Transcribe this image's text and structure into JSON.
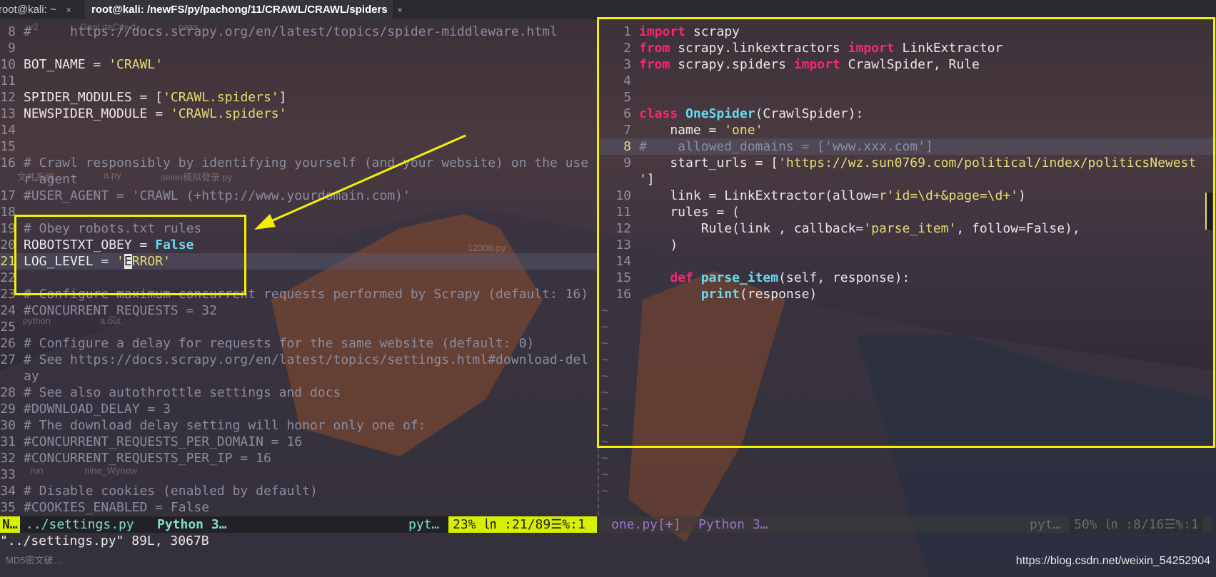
{
  "tabs": [
    {
      "label": "root@kali: ~",
      "close": "×"
    },
    {
      "label": "root@kali: /newFS/py/pachong/11/CRAWL/CRAWL/spiders",
      "close": "×",
      "active": true
    }
  ],
  "desktop_labels": [
    "v2",
    "GeoLiteCity.d",
    "pass",
    "文件系统",
    "a.py",
    "selen模拟登录.py",
    "12306.py",
    "python",
    "a.out",
    "run",
    "nine_Wynew",
    "MD5密文破…"
  ],
  "left_pane": {
    "cursor_line": 21,
    "lines": [
      {
        "n": "8",
        "t": [
          [
            "#     https://docs.scrapy.org/en/latest/topics/spider-middleware.html",
            "c"
          ]
        ]
      },
      {
        "n": "9",
        "t": []
      },
      {
        "n": "10",
        "t": [
          [
            "BOT_NAME = ",
            ""
          ],
          [
            "'CRAWL'",
            "s"
          ]
        ]
      },
      {
        "n": "11",
        "t": []
      },
      {
        "n": "12",
        "t": [
          [
            "SPIDER_MODULES = [",
            ""
          ],
          [
            "'CRAWL.spiders'",
            "s"
          ],
          [
            "]",
            ""
          ]
        ]
      },
      {
        "n": "13",
        "t": [
          [
            "NEWSPIDER_MODULE = ",
            ""
          ],
          [
            "'CRAWL.spiders'",
            "s"
          ]
        ]
      },
      {
        "n": "14",
        "t": []
      },
      {
        "n": "15",
        "t": []
      },
      {
        "n": "16",
        "t": [
          [
            "# Crawl responsibly by identifying yourself (and your website) on the use",
            "c"
          ]
        ],
        "wrap": [
          [
            "r-agent",
            "c"
          ]
        ]
      },
      {
        "n": "17",
        "t": [
          [
            "#USER_AGENT = 'CRAWL (+http://www.yourdomain.com)'",
            "c"
          ]
        ]
      },
      {
        "n": "18",
        "t": []
      },
      {
        "n": "19",
        "t": [
          [
            "# Obey robots.txt rules",
            "c"
          ]
        ]
      },
      {
        "n": "20",
        "t": [
          [
            "ROBOTSTXT_OBEY = ",
            ""
          ],
          [
            "False",
            "b"
          ]
        ]
      },
      {
        "n": "21",
        "t": [
          [
            "LOG_LEVEL = ",
            ""
          ],
          [
            "'",
            "s"
          ],
          [
            "E",
            "cursor"
          ],
          [
            "RROR'",
            "s"
          ]
        ]
      },
      {
        "n": "22",
        "t": []
      },
      {
        "n": "23",
        "t": [
          [
            "# Configure maximum concurrent requests performed by Scrapy (default: 16)",
            "c"
          ]
        ]
      },
      {
        "n": "24",
        "t": [
          [
            "#CONCURRENT_REQUESTS = 32",
            "c"
          ]
        ]
      },
      {
        "n": "25",
        "t": []
      },
      {
        "n": "26",
        "t": [
          [
            "# Configure a delay for requests for the same website (default: 0)",
            "c"
          ]
        ]
      },
      {
        "n": "27",
        "t": [
          [
            "# See https://docs.scrapy.org/en/latest/topics/settings.html#download-del",
            "c"
          ]
        ],
        "wrap": [
          [
            "ay",
            "c"
          ]
        ]
      },
      {
        "n": "28",
        "t": [
          [
            "# See also autothrottle settings and docs",
            "c"
          ]
        ]
      },
      {
        "n": "29",
        "t": [
          [
            "#DOWNLOAD_DELAY = 3",
            "c"
          ]
        ]
      },
      {
        "n": "30",
        "t": [
          [
            "# The download delay setting will honor only one of:",
            "c"
          ]
        ]
      },
      {
        "n": "31",
        "t": [
          [
            "#CONCURRENT_REQUESTS_PER_DOMAIN = 16",
            "c"
          ]
        ]
      },
      {
        "n": "32",
        "t": [
          [
            "#CONCURRENT_REQUESTS_PER_IP = 16",
            "c"
          ]
        ]
      },
      {
        "n": "33",
        "t": []
      },
      {
        "n": "34",
        "t": [
          [
            "# Disable cookies (enabled by default)",
            "c"
          ]
        ]
      },
      {
        "n": "35",
        "t": [
          [
            "#COOKIES_ENABLED = False",
            "c"
          ]
        ]
      }
    ]
  },
  "right_pane": {
    "cursor_line": 8,
    "tilde": "~",
    "tilde_rows": 12,
    "lines": [
      {
        "n": "1",
        "t": [
          [
            "import",
            "k"
          ],
          [
            " scrapy",
            ""
          ]
        ]
      },
      {
        "n": "2",
        "t": [
          [
            "from",
            "k"
          ],
          [
            " scrapy.linkextractors ",
            ""
          ],
          [
            "import",
            "k"
          ],
          [
            " LinkExtractor",
            ""
          ]
        ]
      },
      {
        "n": "3",
        "t": [
          [
            "from",
            "k"
          ],
          [
            " scrapy.spiders ",
            ""
          ],
          [
            "import",
            "k"
          ],
          [
            " CrawlSpider, Rule",
            ""
          ]
        ]
      },
      {
        "n": "4",
        "t": []
      },
      {
        "n": "5",
        "t": []
      },
      {
        "n": "6",
        "t": [
          [
            "class",
            "k"
          ],
          [
            " ",
            ""
          ],
          [
            "OneSpider",
            "f"
          ],
          [
            "(CrawlSpider):",
            ""
          ]
        ]
      },
      {
        "n": "7",
        "t": [
          [
            "    name = ",
            ""
          ],
          [
            "'one'",
            "s"
          ]
        ]
      },
      {
        "n": "8",
        "t": [
          [
            "#    allowed_domains = ['www.xxx.com']",
            "c"
          ]
        ]
      },
      {
        "n": "9",
        "t": [
          [
            "    start_urls = [",
            ""
          ],
          [
            "'https://wz.sun0769.com/political/index/politicsNewest",
            "s"
          ]
        ],
        "wrap": [
          [
            "'",
            "s"
          ],
          [
            "]",
            ""
          ]
        ]
      },
      {
        "n": "10",
        "t": [
          [
            "    link = LinkExtractor(allow=",
            ""
          ],
          [
            "r'id=\\d+&page=\\d+'",
            "s"
          ],
          [
            ")",
            ""
          ]
        ]
      },
      {
        "n": "11",
        "t": [
          [
            "    rules = (",
            ""
          ]
        ]
      },
      {
        "n": "12",
        "t": [
          [
            "        Rule(link , callback=",
            ""
          ],
          [
            "'parse_item'",
            "s"
          ],
          [
            ", follow=False),",
            ""
          ]
        ]
      },
      {
        "n": "13",
        "t": [
          [
            "    )",
            ""
          ]
        ]
      },
      {
        "n": "14",
        "t": []
      },
      {
        "n": "15",
        "t": [
          [
            "    ",
            ""
          ],
          [
            "def",
            "k"
          ],
          [
            " ",
            ""
          ],
          [
            "parse_item",
            "f"
          ],
          [
            "(self, response):",
            ""
          ]
        ]
      },
      {
        "n": "16",
        "t": [
          [
            "        ",
            ""
          ],
          [
            "print",
            "f"
          ],
          [
            "(response)",
            ""
          ]
        ]
      }
    ]
  },
  "status_left": {
    "mode": "N…",
    "file": "../settings.py",
    "filetype": "Python 3…",
    "enc": "pyt…",
    "position": "23% ㏑ :21/89☰%:1"
  },
  "status_right": {
    "file": "one.py[+]",
    "filetype": "Python 3…",
    "enc": "pyt…",
    "position": "50% ㏑ :8/16☰%:1"
  },
  "cmdline": "\"../settings.py\" 89L, 3067B",
  "watermark": "https://blog.csdn.net/weixin_54252904",
  "colors": {
    "annotation": "#f5f000",
    "status_accent": "#d7f000",
    "string": "#e6db74",
    "keyword": "#f92672",
    "function": "#66d9ef"
  }
}
